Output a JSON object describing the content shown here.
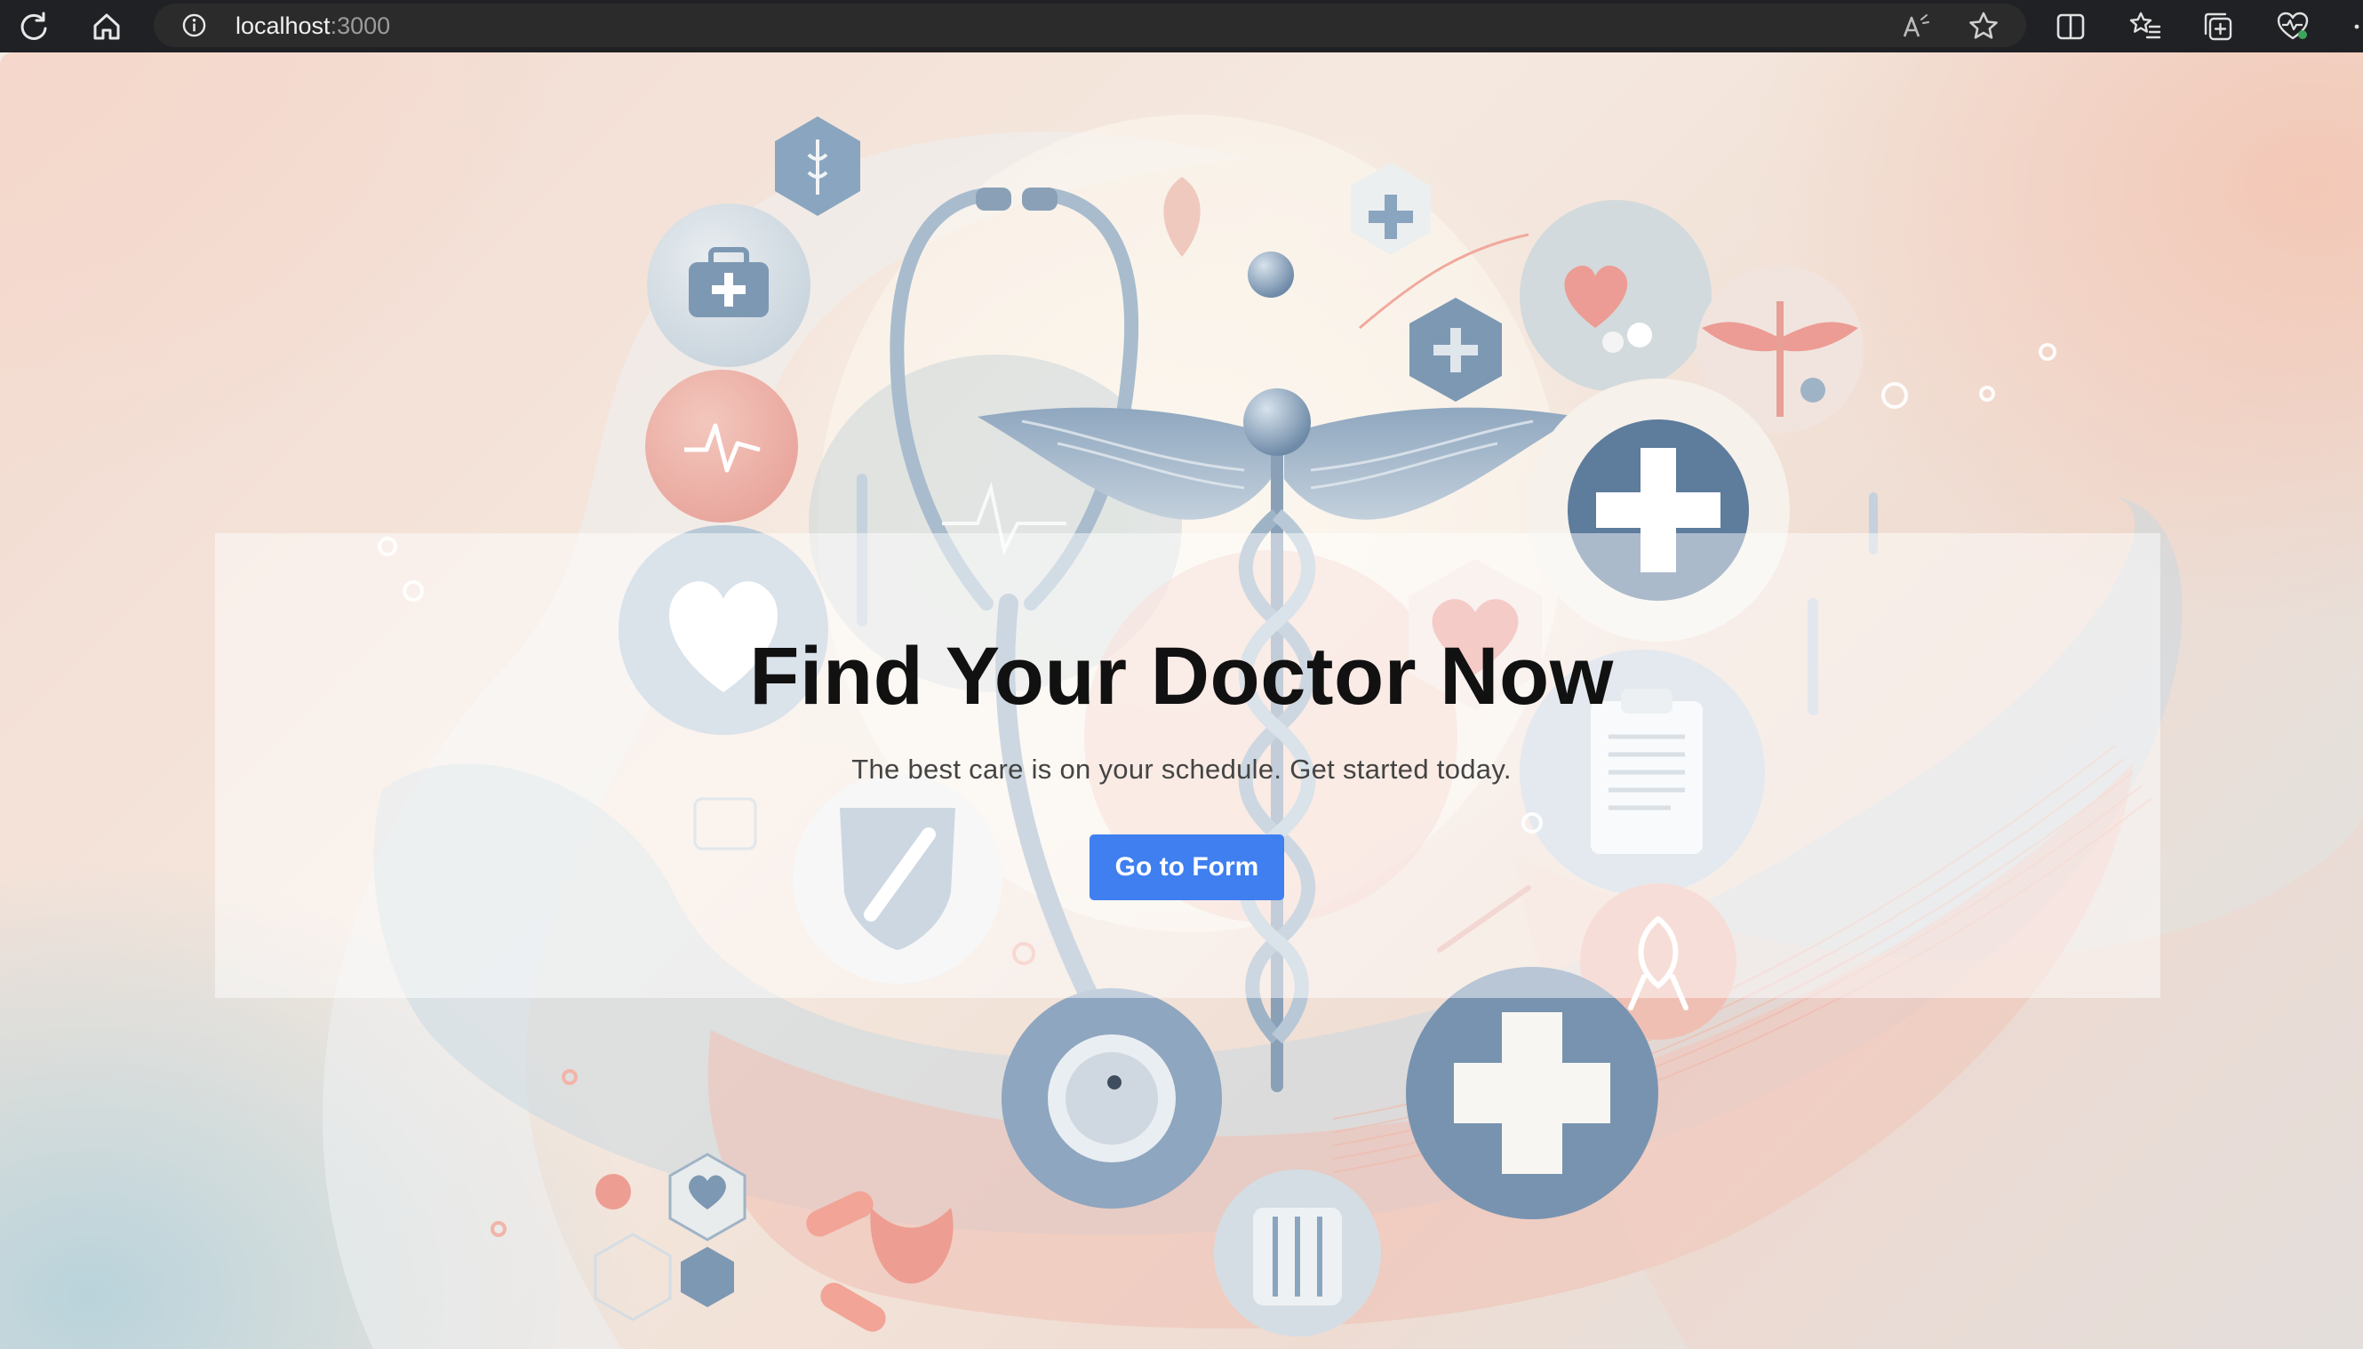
{
  "browser": {
    "url_host": "localhost",
    "url_port": ":3000",
    "icons": [
      "reload-icon",
      "home-icon",
      "site-info-icon",
      "read-aloud-icon",
      "favorite-star-icon",
      "split-screen-icon",
      "favorites-icon",
      "collections-icon",
      "browser-essentials-icon",
      "more-icon"
    ]
  },
  "hero": {
    "title": "Find Your Doctor Now",
    "subtitle": "The best care is on your schedule. Get started today.",
    "cta_label": "Go to Form"
  },
  "colors": {
    "button": "#3f7ff0",
    "toolbar": "#202124",
    "icon_blue": "#7d98b3",
    "icon_pink": "#e8a39a"
  }
}
